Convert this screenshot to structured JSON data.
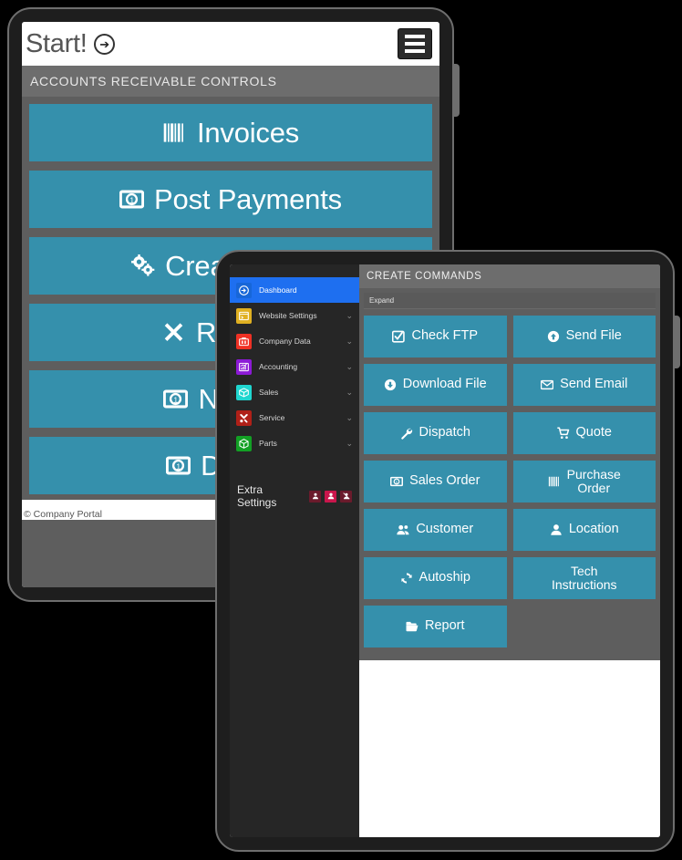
{
  "tablet_a": {
    "header": {
      "brand": "Start!",
      "brand_icon": "arrow-circle-right-icon",
      "menu_icon": "hamburger-icon"
    },
    "panel": {
      "title": "ACCOUNTS RECEIVABLE CONTROLS",
      "buttons": [
        {
          "label": "Invoices",
          "icon": "barcode-icon"
        },
        {
          "label": "Post Payments",
          "icon": "money-bill-icon"
        },
        {
          "label": "Create Credit",
          "icon": "cogs-icon"
        },
        {
          "label": "Reverse",
          "icon": "times-icon"
        },
        {
          "label": "Non-AR",
          "icon": "money-bill-icon"
        },
        {
          "label": "Deposit",
          "icon": "money-bill-icon"
        }
      ]
    },
    "footer": {
      "copyright": "© Company Portal"
    }
  },
  "tablet_b": {
    "sidebar": {
      "items": [
        {
          "label": "Dashboard",
          "icon": "arrow-circle-right-icon",
          "color": "#1e6ff0",
          "active": true,
          "chevron": ""
        },
        {
          "label": "Website Settings",
          "icon": "window-icon",
          "color": "#e0b021",
          "active": false,
          "chevron": "⌄"
        },
        {
          "label": "Company Data",
          "icon": "briefcase-icon",
          "color": "#ef3124",
          "active": false,
          "chevron": "⌄"
        },
        {
          "label": "Accounting",
          "icon": "chart-bar-icon",
          "color": "#8c1ad6",
          "active": false,
          "chevron": "⌄"
        },
        {
          "label": "Sales",
          "icon": "box-icon",
          "color": "#1fd6cf",
          "active": false,
          "chevron": "⌄"
        },
        {
          "label": "Service",
          "icon": "tools-icon",
          "color": "#b02018",
          "active": false,
          "chevron": "⌄"
        },
        {
          "label": "Parts",
          "icon": "cube-icon",
          "color": "#12a024",
          "active": false,
          "chevron": "⌄"
        }
      ],
      "extra": {
        "label": "Extra Settings",
        "buttons": [
          {
            "icon": "user-download-icon",
            "color": "#6b1b2c"
          },
          {
            "icon": "user-icon",
            "color": "#c9164c"
          },
          {
            "icon": "user-slash-icon",
            "color": "#6b1b2c"
          }
        ]
      }
    },
    "commands": {
      "title": "CREATE COMMANDS",
      "expand_label": "Expand",
      "buttons": [
        {
          "label": "Check FTP",
          "icon": "check-square-icon",
          "two_line": false
        },
        {
          "label": "Send File",
          "icon": "arrow-circle-up-icon",
          "two_line": false
        },
        {
          "label": "Download File",
          "icon": "arrow-circle-down-icon",
          "two_line": false
        },
        {
          "label": "Send Email",
          "icon": "envelope-icon",
          "two_line": false
        },
        {
          "label": "Dispatch",
          "icon": "wrench-icon",
          "two_line": false
        },
        {
          "label": "Quote",
          "icon": "shopping-cart-icon",
          "two_line": false
        },
        {
          "label": "Sales Order",
          "icon": "money-bill-icon",
          "two_line": false
        },
        {
          "label": "Purchase Order",
          "icon": "barcode-icon",
          "two_line": true
        },
        {
          "label": "Customer",
          "icon": "users-icon",
          "two_line": false
        },
        {
          "label": "Location",
          "icon": "user-icon",
          "two_line": false
        },
        {
          "label": "Autoship",
          "icon": "sync-icon",
          "two_line": false
        },
        {
          "label": "Tech Instructions",
          "icon": "",
          "two_line": true
        },
        {
          "label": "Report",
          "icon": "folder-open-icon",
          "two_line": false
        }
      ]
    }
  },
  "colors": {
    "accent_teal": "#3590ac",
    "panel_gray": "#5e5e5e",
    "title_gray": "#6d6d6d",
    "nav_active_blue": "#1e6ff0",
    "bezel": "#1e1e1e"
  }
}
